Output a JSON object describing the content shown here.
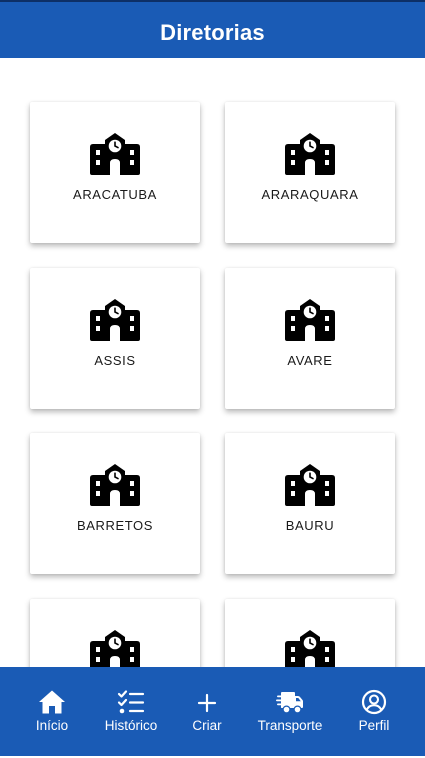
{
  "header": {
    "title": "Diretorias"
  },
  "cards": [
    {
      "label": "ARACATUBA",
      "icon": "school-icon"
    },
    {
      "label": "ARARAQUARA",
      "icon": "school-icon"
    },
    {
      "label": "ASSIS",
      "icon": "school-icon"
    },
    {
      "label": "AVARE",
      "icon": "school-icon"
    },
    {
      "label": "BARRETOS",
      "icon": "school-icon"
    },
    {
      "label": "BAURU",
      "icon": "school-icon"
    },
    {
      "label": "",
      "icon": "school-icon"
    },
    {
      "label": "",
      "icon": "school-icon"
    }
  ],
  "nav": {
    "items": [
      {
        "label": "Início",
        "icon": "home-icon",
        "active": true
      },
      {
        "label": "Histórico",
        "icon": "checklist-icon"
      },
      {
        "label": "Criar",
        "icon": "plus-icon"
      },
      {
        "label": "Transporte",
        "icon": "truck-fast-icon"
      },
      {
        "label": "Perfil",
        "icon": "user-circle-icon"
      }
    ]
  },
  "colors": {
    "primary": "#1a5bb5",
    "card_background": "#ffffff",
    "text": "#1a1a1a",
    "nav_text": "#ffffff"
  }
}
